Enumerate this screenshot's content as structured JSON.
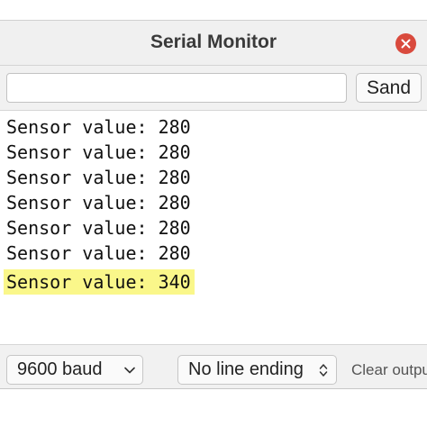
{
  "window": {
    "title": "Serial Monitor"
  },
  "input": {
    "value": "",
    "placeholder": "",
    "send_label": "Sand"
  },
  "output": {
    "lines": [
      "Sensor value: 280",
      "Sensor value: 280",
      "Sensor value: 280",
      "Sensor value: 280",
      "Sensor value: 280",
      "Sensor value: 280",
      "Sensor value: 340"
    ],
    "highlighted_line": 6,
    "highlight_color": "#faf78a"
  },
  "footer": {
    "baud_selected": "9600 baud",
    "line_ending_selected": "No line ending",
    "clear_label": "Clear output"
  },
  "colors": {
    "close_button": "#d94a3d"
  },
  "icons": {
    "close": "close-icon",
    "baud_arrow": "chevron-down-icon",
    "ending_arrow": "up-down-chevron-icon"
  }
}
